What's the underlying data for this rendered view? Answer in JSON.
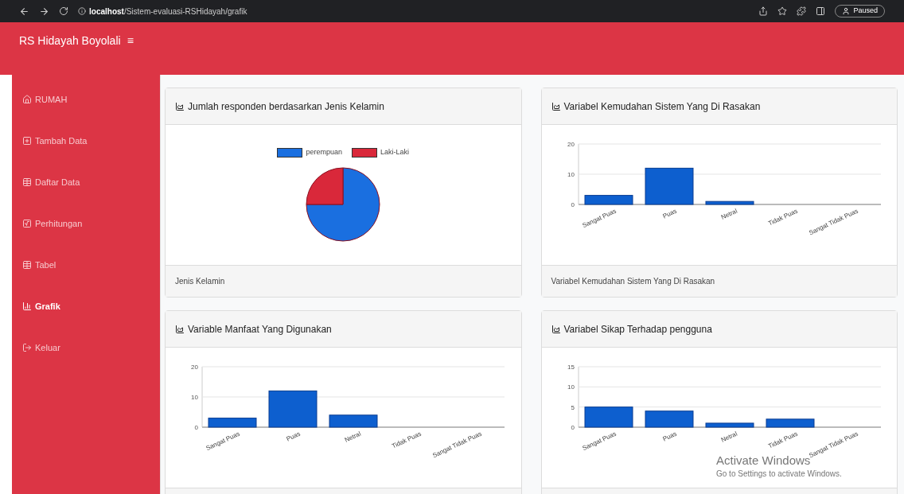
{
  "browser": {
    "url_host": "localhost",
    "url_path": "/Sistem-evaluasi-RSHidayah/grafik",
    "profile_label": "Paused"
  },
  "header": {
    "brand": "RS Hidayah Boyolali",
    "menu_toggle": "≡"
  },
  "sidebar": {
    "items": [
      {
        "label": "RUMAH",
        "kind": "home",
        "selected": false
      },
      {
        "label": "Tambah Data",
        "kind": "add",
        "selected": false
      },
      {
        "label": "Daftar Data",
        "kind": "table",
        "selected": false
      },
      {
        "label": "Perhitungan",
        "kind": "sqrt",
        "selected": false
      },
      {
        "label": "Tabel",
        "kind": "table",
        "selected": false
      },
      {
        "label": "Grafik",
        "kind": "chart",
        "selected": true
      },
      {
        "label": "Keluar",
        "kind": "logout",
        "selected": false
      }
    ]
  },
  "cards": [
    {
      "title": "Jumlah responden berdasarkan Jenis Kelamin",
      "footer": "Jenis Kelamin",
      "chart_data": {
        "type": "pie",
        "legend": "top",
        "categories": [
          "perempuan",
          "Laki-Laki"
        ],
        "series": [
          {
            "values": [
              75,
              25
            ],
            "colors": [
              "#1a6fe0",
              "#d9283a"
            ]
          }
        ]
      }
    },
    {
      "title": "Variabel Kemudahan Sistem Yang Di Rasakan",
      "footer": "Variabel Kemudahan Sistem Yang Di Rasakan",
      "chart_data": {
        "type": "bar",
        "categories": [
          "Sangat Puas",
          "Puas",
          "Netral",
          "Tidak Puas",
          "Sangat Tidak Puas"
        ],
        "series": [
          {
            "color": "#0d5fcf",
            "values": [
              3,
              12,
              1,
              0,
              0
            ]
          }
        ],
        "ylim": [
          0,
          20
        ],
        "yticks": [
          0,
          10,
          20
        ]
      }
    },
    {
      "title": "Variable Manfaat Yang Digunakan",
      "chart_data": {
        "type": "bar",
        "categories": [
          "Sangat Puas",
          "Puas",
          "Netral",
          "Tidak Puas",
          "Sangat Tidak Puas"
        ],
        "series": [
          {
            "color": "#0d5fcf",
            "values": [
              3,
              12,
              4,
              0,
              0
            ]
          }
        ],
        "ylim": [
          0,
          20
        ],
        "yticks": [
          0,
          10,
          20
        ]
      }
    },
    {
      "title": "Variabel Sikap Terhadap pengguna",
      "chart_data": {
        "type": "bar",
        "categories": [
          "Sangat Puas",
          "Puas",
          "Netral",
          "Tidak Puas",
          "Sangat Tidak Puas"
        ],
        "series": [
          {
            "color": "#0d5fcf",
            "values": [
              5,
              4,
              1,
              2,
              0
            ]
          }
        ],
        "ylim": [
          0,
          15
        ],
        "yticks": [
          0,
          5,
          10,
          15
        ]
      }
    }
  ],
  "os_notice": {
    "title": "Activate Windows",
    "message": "Go to Settings to activate Windows."
  }
}
